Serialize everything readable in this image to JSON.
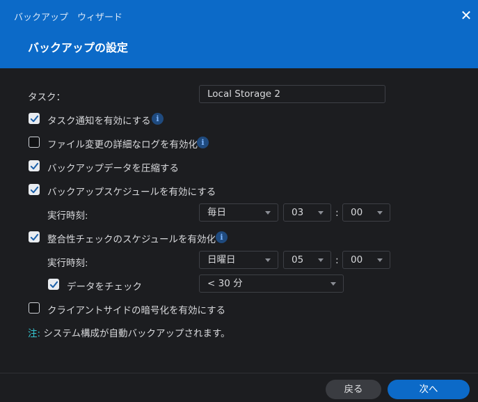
{
  "header": {
    "wizard_name": "バックアップ　ウィザード",
    "page_title": "バックアップの設定",
    "close_glyph": "✕"
  },
  "form": {
    "task_label": "タスク：",
    "task_value": "Local Storage 2",
    "options": {
      "task_notification": {
        "label": "タスク通知を有効にする",
        "checked": true
      },
      "detailed_log": {
        "label": "ファイル変更の詳細なログを有効化",
        "checked": false
      },
      "compress": {
        "label": "バックアップデータを圧縮する",
        "checked": true
      },
      "backup_schedule": {
        "label": "バックアップスケジュールを有効にする",
        "checked": true
      },
      "integrity_schedule": {
        "label": "整合性チェックのスケジュールを有効化",
        "checked": true
      },
      "check_data": {
        "label": "データをチェック",
        "checked": true
      },
      "client_encryption": {
        "label": "クライアントサイドの暗号化を有効にする",
        "checked": false
      }
    },
    "backup_run_time": {
      "label": "実行時刻:",
      "frequency": "毎日",
      "hour": "03",
      "minute": "00"
    },
    "integrity_run_time": {
      "label": "実行時刻:",
      "frequency": "日曜日",
      "hour": "05",
      "minute": "00"
    },
    "check_duration": "< 30 分",
    "info_glyph": "i",
    "time_separator": ":"
  },
  "note": {
    "label": "注:",
    "text": " システム構成が自動バックアップされます。"
  },
  "footer": {
    "back_label": "戻る",
    "next_label": "次へ"
  },
  "colors": {
    "accent": "#0c6ac8",
    "background": "#1c1d20",
    "note_label": "#35c5d0"
  }
}
